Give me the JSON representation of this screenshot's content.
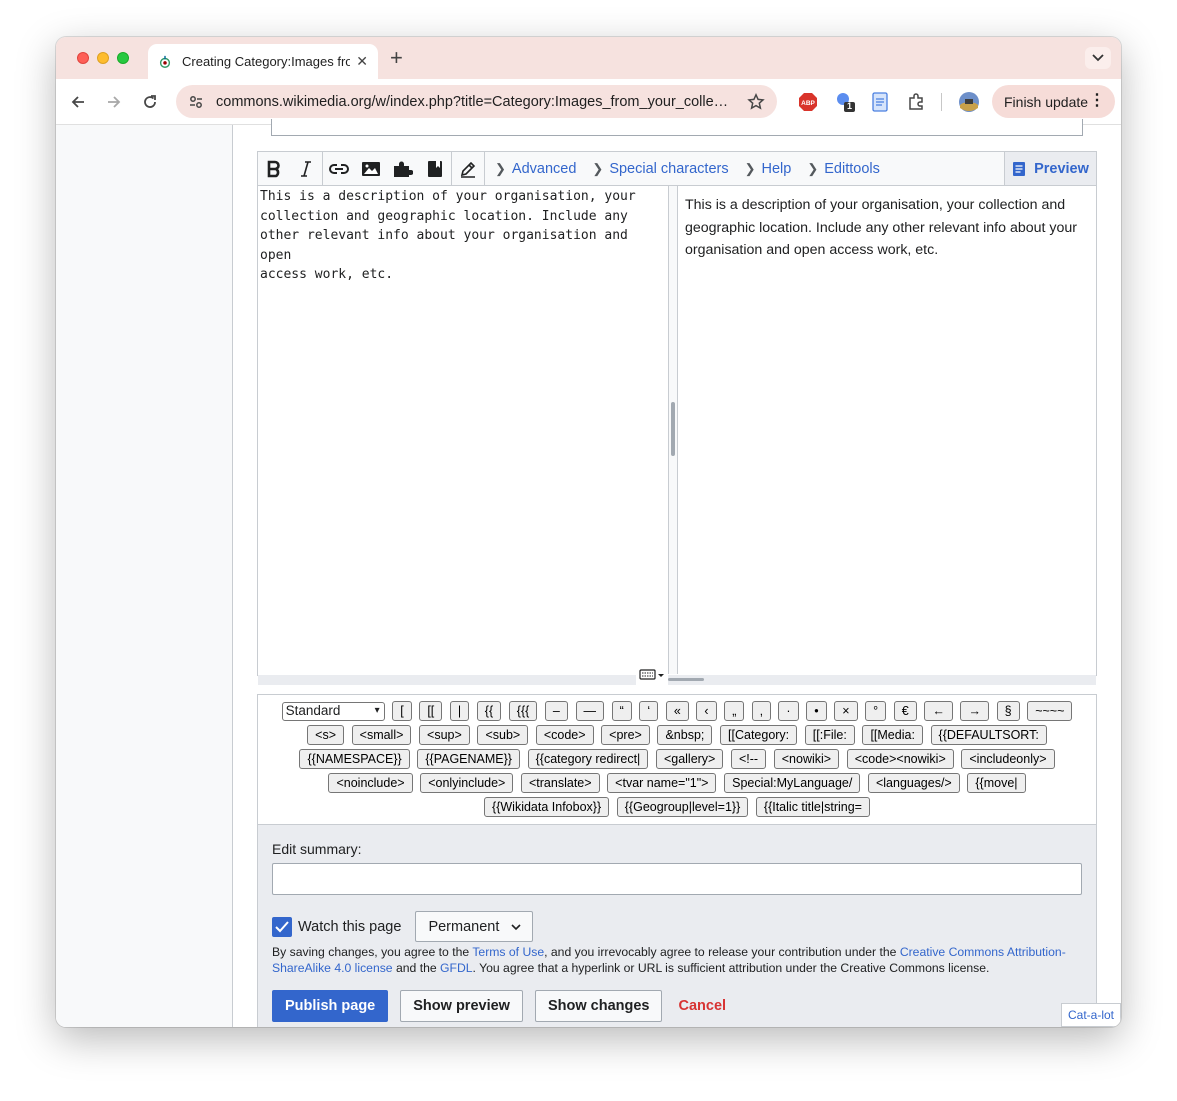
{
  "browser": {
    "tab_title": "Creating Category:Images fro",
    "tab_close": "✕",
    "new_tab": "+",
    "url": "commons.wikimedia.org/w/index.php?title=Category:Images_from_your_colle…",
    "finish_update": "Finish update",
    "ext_badge": "1"
  },
  "toolbar": {
    "links": [
      {
        "label": "Advanced"
      },
      {
        "label": "Special characters"
      },
      {
        "label": "Help"
      },
      {
        "label": "Edittools"
      }
    ],
    "preview": "Preview"
  },
  "editor": {
    "source_lines": [
      "This is a description of your organisation, your",
      "collection and geographic location. Include any",
      "other relevant info about your organisation and open",
      "access work, etc."
    ],
    "preview_text": "This is a description of your organisation, your collection and geographic location. Include any other relevant info about your organisation and open access work, etc."
  },
  "edittools": {
    "select_value": "Standard",
    "buttons": [
      "[",
      "[[",
      "|",
      "{{",
      "{{{",
      "–",
      "—",
      "“",
      "‘",
      "«",
      "‹",
      "„",
      "‚",
      "·",
      "•",
      "×",
      "°",
      "€",
      "←",
      "→",
      "§",
      "~~~~",
      "<s>",
      "<small>",
      "<sup>",
      "<sub>",
      "<code>",
      "<pre>",
      "&nbsp;",
      "[[Category:",
      "[[:File:",
      "[[Media:",
      "{{DEFAULTSORT:",
      "{{NAMESPACE}}",
      "{{PAGENAME}}",
      "{{category redirect|",
      "<gallery>",
      "<!--",
      "<nowiki>",
      "<code><nowiki>",
      "<includeonly>",
      "<noinclude>",
      "<onlyinclude>",
      "<translate>",
      "<tvar name=\"1\">",
      "Special:MyLanguage/",
      "<languages/>",
      "{{move|",
      "{{Wikidata Infobox}}",
      "{{Geogroup|level=1}}",
      "{{Italic title|string="
    ]
  },
  "summary": {
    "label": "Edit summary",
    "colon": ":",
    "value": ""
  },
  "watch": {
    "label": "Watch this page",
    "expiry": "Permanent",
    "checked": true
  },
  "legal": {
    "part1": "By saving changes, you agree to the ",
    "terms": "Terms of Use",
    "part2": ", and you irrevocably agree to release your contribution under the ",
    "license": "Creative Commons Attribution-ShareAlike 4.0 license",
    "part3": " and the ",
    "gfdl": "GFDL",
    "part4": ". You agree that a hyperlink or URL is sufficient attribution under the Creative Commons license."
  },
  "actions": {
    "publish": "Publish page",
    "show_preview": "Show preview",
    "show_changes": "Show changes",
    "cancel": "Cancel"
  },
  "catalot": "Cat-a-lot",
  "colors": {
    "link": "#3366cc",
    "cancel": "#d73333",
    "tabstrip": "#f6e2df"
  }
}
